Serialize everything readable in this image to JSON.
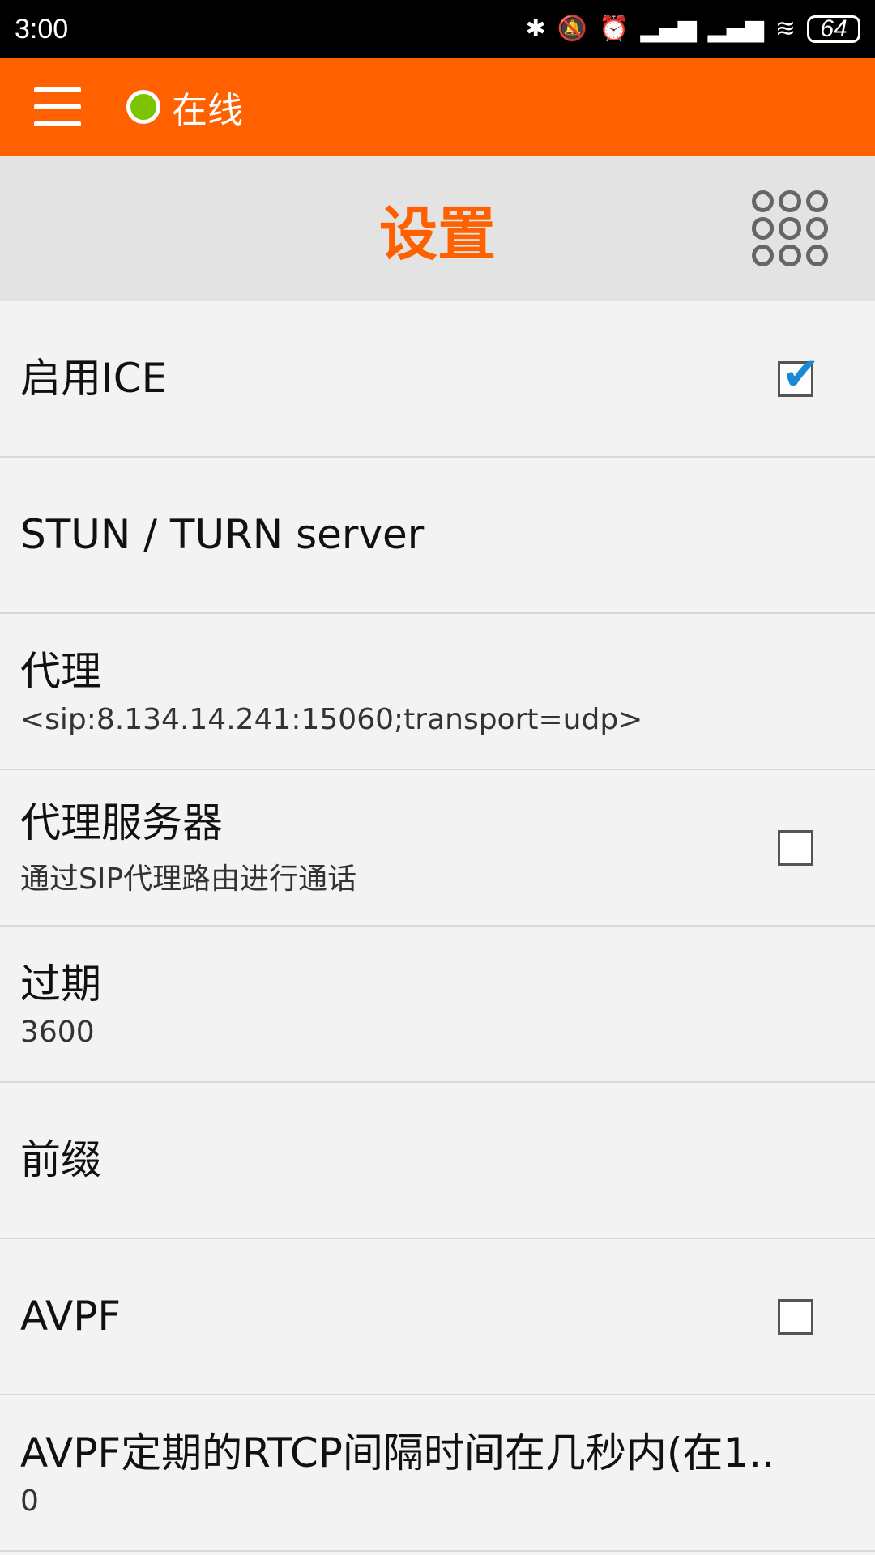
{
  "status_bar": {
    "time": "3:00",
    "battery": "64",
    "icons": [
      "bluetooth-icon",
      "mute-icon",
      "alarm-icon",
      "signal-icon",
      "signal-icon",
      "wifi-icon",
      "battery-icon"
    ]
  },
  "top_bar": {
    "status_label": "在线",
    "status_color": "#7cc400",
    "accent_color": "#ff6000"
  },
  "header": {
    "title": "设置"
  },
  "settings": [
    {
      "title": "启用ICE",
      "subtitle": "",
      "checkbox": true
    },
    {
      "title": "STUN / TURN server",
      "subtitle": ""
    },
    {
      "title": "代理",
      "subtitle": "<sip:8.134.14.241:15060;transport=udp>"
    },
    {
      "title": "代理服务器",
      "subtitle": "通过SIP代理路由进行通话",
      "checkbox": false
    },
    {
      "title": "过期",
      "subtitle": "3600"
    },
    {
      "title": "前缀",
      "subtitle": ""
    },
    {
      "title": "AVPF",
      "subtitle": "",
      "checkbox": false
    },
    {
      "title": "AVPF定期的RTCP间隔时间在几秒内(在1..",
      "subtitle": "0"
    }
  ]
}
